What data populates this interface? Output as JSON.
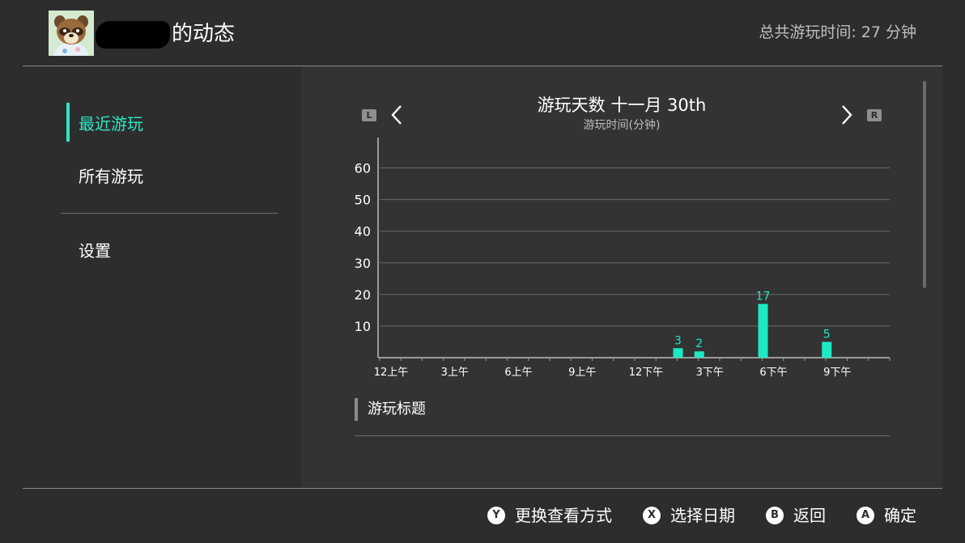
{
  "header": {
    "title_suffix": "的动态",
    "total_playtime": "总共游玩时间: 27 分钟"
  },
  "sidebar": {
    "items": [
      {
        "label": "最近游玩",
        "active": true
      },
      {
        "label": "所有游玩",
        "active": false
      },
      {
        "label": "设置",
        "active": false
      }
    ]
  },
  "chart_nav": {
    "left_badge": "L",
    "right_badge": "R"
  },
  "chart_data": {
    "type": "bar",
    "title": "游玩天数 十一月 30th",
    "ylabel": "游玩时间(分钟)",
    "x_ticks": [
      "12上午",
      "3上午",
      "6上午",
      "9上午",
      "12下午",
      "3下午",
      "6下午",
      "9下午"
    ],
    "y_ticks": [
      10,
      20,
      30,
      40,
      50,
      60
    ],
    "ylim": [
      0,
      65
    ],
    "hour_range": [
      0,
      24
    ],
    "bars": [
      {
        "hour": 14,
        "value": 3
      },
      {
        "hour": 15,
        "value": 2
      },
      {
        "hour": 18,
        "value": 17
      },
      {
        "hour": 21,
        "value": 5
      }
    ],
    "bar_color": "#1de9c4",
    "grid": true
  },
  "section": {
    "title": "游玩标题"
  },
  "footer": {
    "buttons": [
      {
        "icon": "Y",
        "label": "更换查看方式"
      },
      {
        "icon": "X",
        "label": "选择日期"
      },
      {
        "icon": "B",
        "label": "返回"
      },
      {
        "icon": "A",
        "label": "确定"
      }
    ]
  }
}
